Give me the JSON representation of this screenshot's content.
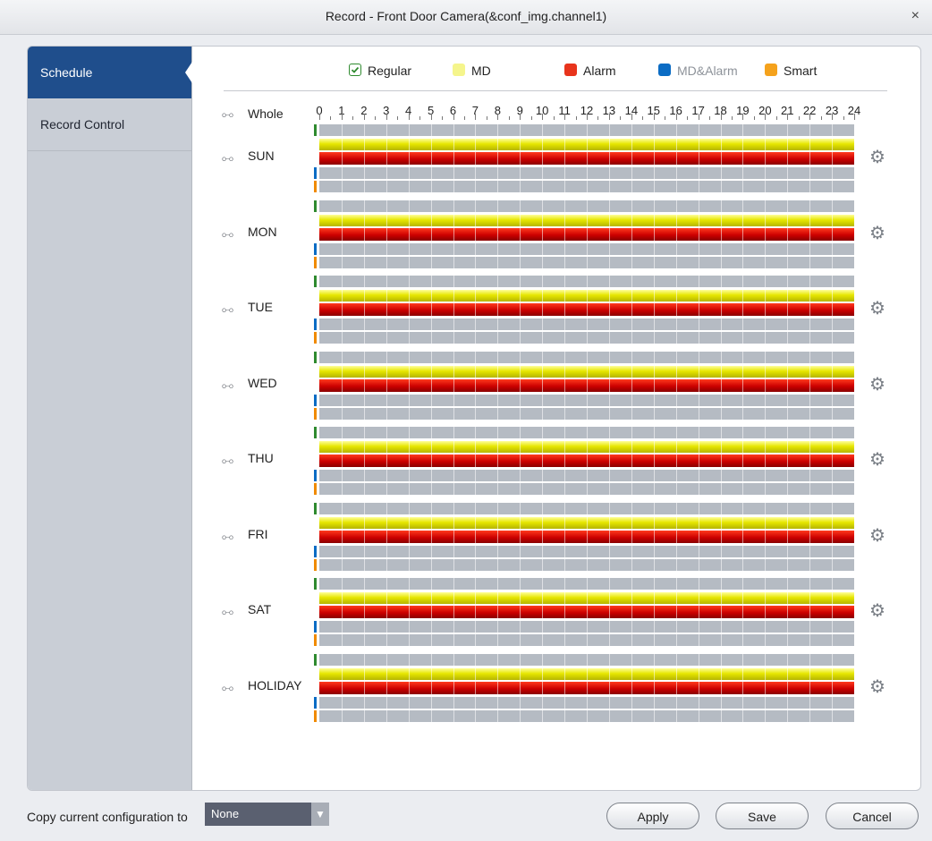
{
  "window": {
    "title": "Record - Front Door Camera(&conf_img.channel1)",
    "close": "×"
  },
  "sidebar": {
    "items": [
      {
        "label": "Schedule"
      },
      {
        "label": "Record Control"
      }
    ]
  },
  "legend": {
    "items": [
      {
        "label": "Regular",
        "color": "#2f8a2f",
        "checked": true
      },
      {
        "label": "MD",
        "color": "#f5f58c"
      },
      {
        "label": "Alarm",
        "color": "#e8341c"
      },
      {
        "label": "MD&Alarm",
        "color": "#0b6cc4",
        "muted": true
      },
      {
        "label": "Smart",
        "color": "#f5a21c"
      }
    ]
  },
  "timeline": {
    "whole_label": "Whole",
    "hours": [
      "0",
      "1",
      "2",
      "3",
      "4",
      "5",
      "6",
      "7",
      "8",
      "9",
      "10",
      "11",
      "12",
      "13",
      "14",
      "15",
      "16",
      "17",
      "18",
      "19",
      "20",
      "21",
      "22",
      "23",
      "24"
    ]
  },
  "days": [
    {
      "label": "SUN"
    },
    {
      "label": "MON"
    },
    {
      "label": "TUE"
    },
    {
      "label": "WED"
    },
    {
      "label": "THU"
    },
    {
      "label": "FRI"
    },
    {
      "label": "SAT"
    },
    {
      "label": "HOLIDAY"
    }
  ],
  "footer": {
    "copy_label": "Copy current configuration to",
    "copy_value": "None",
    "apply": "Apply",
    "save": "Save",
    "cancel": "Cancel"
  }
}
